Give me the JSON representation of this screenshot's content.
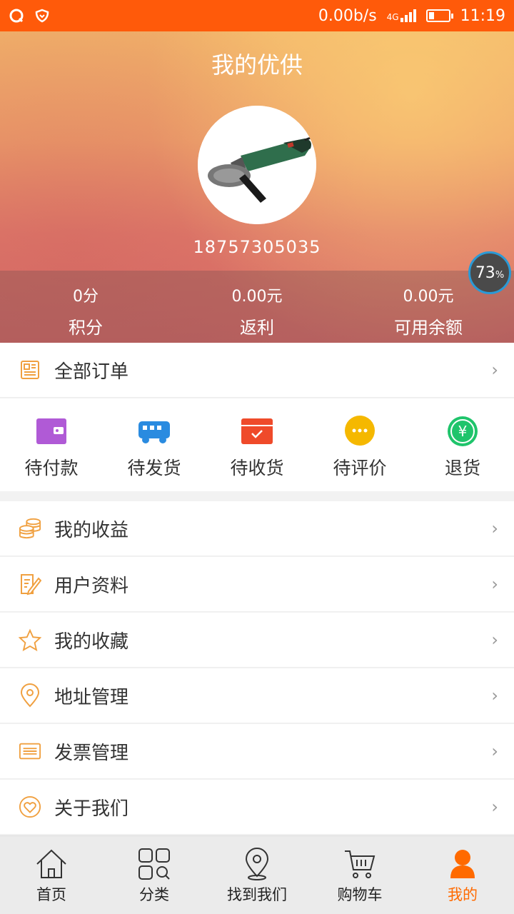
{
  "status_bar": {
    "net_speed": "0.00b/s",
    "network": "4G",
    "time": "11:19",
    "battery_level": 0.3
  },
  "header": {
    "title": "我的优供",
    "phone": "18757305035",
    "stats": [
      {
        "value": "0分",
        "label": "积分"
      },
      {
        "value": "0.00元",
        "label": "返利"
      },
      {
        "value": "0.00元",
        "label": "可用余额"
      }
    ],
    "progress": {
      "value": "73",
      "unit": "%"
    }
  },
  "all_orders": {
    "label": "全部订单"
  },
  "order_status": [
    {
      "label": "待付款",
      "icon": "wallet-icon",
      "color": "#b05ad6"
    },
    {
      "label": "待发货",
      "icon": "truck-icon",
      "color": "#2a8be0"
    },
    {
      "label": "待收货",
      "icon": "box-icon",
      "color": "#ef4a2a"
    },
    {
      "label": "待评价",
      "icon": "chat-icon",
      "color": "#f5b800"
    },
    {
      "label": "退货",
      "icon": "yen-icon",
      "color": "#1fc46b"
    }
  ],
  "menu": [
    {
      "label": "我的收益",
      "icon": "coins-icon"
    },
    {
      "label": "用户资料",
      "icon": "edit-document-icon"
    },
    {
      "label": "我的收藏",
      "icon": "star-icon"
    },
    {
      "label": "地址管理",
      "icon": "location-pin-icon"
    },
    {
      "label": "发票管理",
      "icon": "invoice-icon"
    },
    {
      "label": "关于我们",
      "icon": "heart-icon"
    }
  ],
  "bottom_nav": [
    {
      "label": "首页",
      "icon": "home-icon"
    },
    {
      "label": "分类",
      "icon": "grid-icon"
    },
    {
      "label": "找到我们",
      "icon": "location-pin-icon"
    },
    {
      "label": "购物车",
      "icon": "cart-icon"
    },
    {
      "label": "我的",
      "icon": "user-icon"
    }
  ],
  "colors": {
    "accent": "#ff6a00",
    "status_bar": "#ff5a0a",
    "icon_outline": "#f0a040"
  }
}
